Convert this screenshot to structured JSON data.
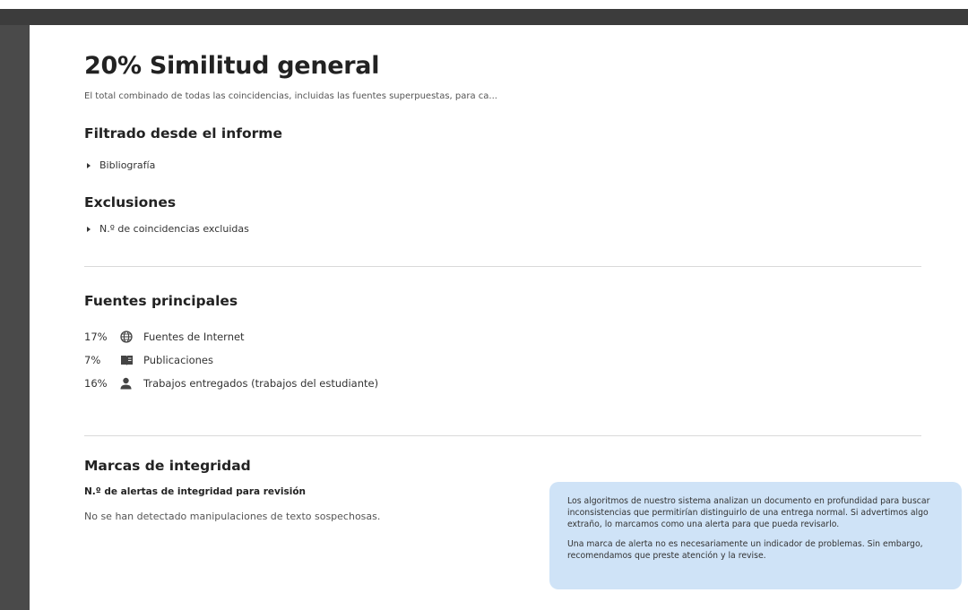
{
  "report": {
    "title": "20% Similitud general",
    "subtitle": "El total combinado de todas las coincidencias, incluidas las fuentes superpuestas, para ca..."
  },
  "filtered": {
    "heading": "Filtrado desde el informe",
    "items": [
      "Bibliografía"
    ]
  },
  "exclusions": {
    "heading": "Exclusiones",
    "items": [
      "N.º de coincidencias excluidas"
    ]
  },
  "sources": {
    "heading": "Fuentes principales",
    "items": [
      {
        "percent": "17%",
        "icon": "globe-icon",
        "label": "Fuentes de Internet"
      },
      {
        "percent": "7%",
        "icon": "book-icon",
        "label": "Publicaciones"
      },
      {
        "percent": "16%",
        "icon": "person-icon",
        "label": "Trabajos entregados (trabajos del estudiante)"
      }
    ]
  },
  "integrity": {
    "heading": "Marcas de integridad",
    "subheading": "N.º de alertas de integridad para revisión",
    "none_text": "No se han detectado manipulaciones de texto sospechosas.",
    "info_paragraph_1": "Los algoritmos de nuestro sistema analizan un documento en profundidad para buscar inconsistencias que permitirían distinguirlo de una entrega normal. Si advertimos algo extraño, lo marcamos como una alerta para que pueda revisarlo.",
    "info_paragraph_2": "Una marca de alerta no es necesariamente un indicador de problemas. Sin embargo, recomendamos que preste atención y la revise."
  },
  "colors": {
    "info_box_bg": "#cfe3f7",
    "viewer_bg": "#4a4a4a"
  }
}
